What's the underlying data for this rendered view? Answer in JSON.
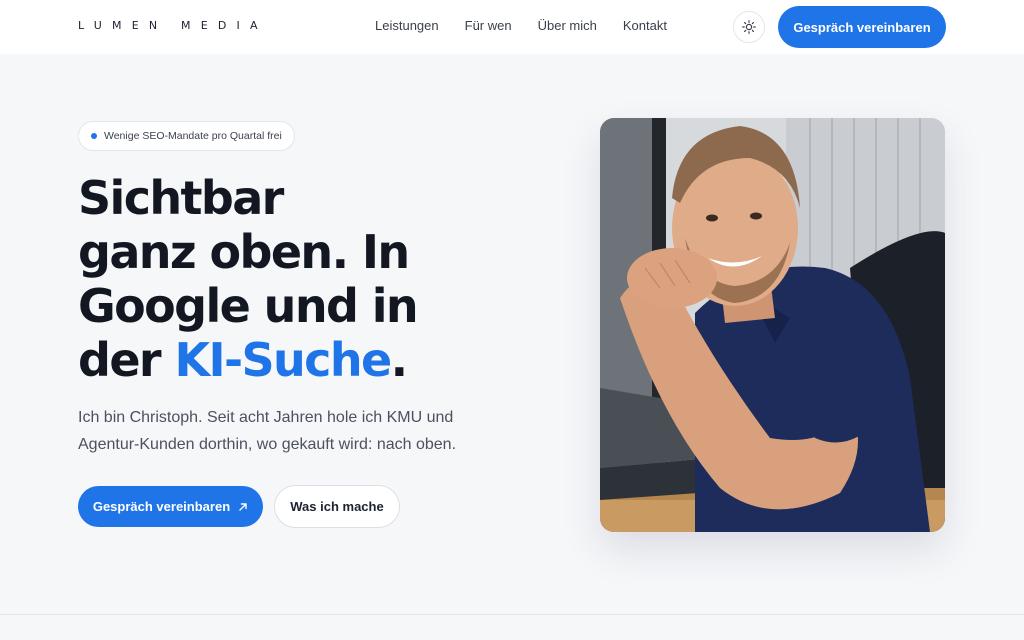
{
  "header": {
    "logo": "LUMEN MEDIA",
    "nav": [
      "Leistungen",
      "Für wen",
      "Über mich",
      "Kontakt"
    ],
    "theme_toggle_icon": "sun-icon",
    "cta_label": "Gespräch vereinbaren"
  },
  "hero": {
    "badge": "Wenige SEO-Mandate pro Quartal frei",
    "title_lines": [
      "Sichtbar",
      "ganz oben. In",
      "Google und in"
    ],
    "title_last_prefix": "der ",
    "title_accent": "KI-Suche",
    "title_suffix": ".",
    "subtitle": "Ich bin Christoph. Seit acht Jahren hole ich KMU und Agentur-Kunden dorthin, wo gekauft wird: nach oben.",
    "primary_cta": "Gespräch vereinbaren",
    "primary_cta_icon": "arrow-up-right-icon",
    "secondary_cta": "Was ich mache"
  },
  "colors": {
    "accent": "#1f74e8",
    "text": "#131722",
    "background": "#f6f7f9"
  }
}
